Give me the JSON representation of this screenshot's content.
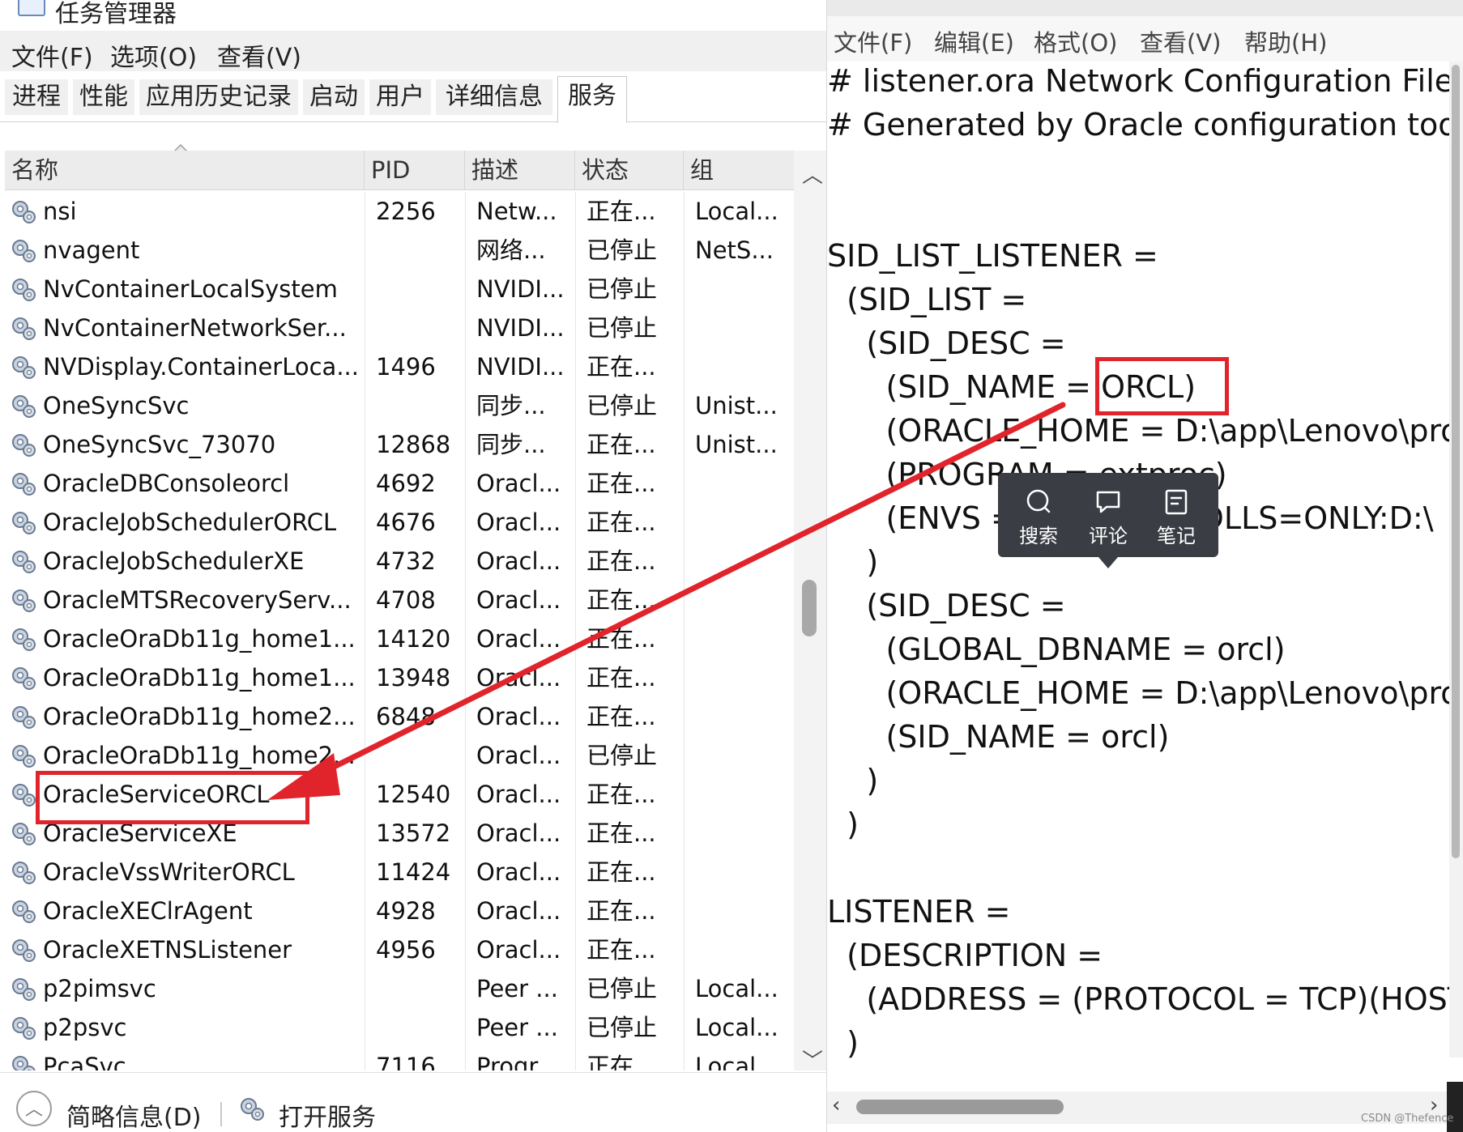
{
  "task_manager": {
    "title": "任务管理器",
    "menu": [
      "文件(F)",
      "选项(O)",
      "查看(V)"
    ],
    "tabs": [
      "进程",
      "性能",
      "应用历史记录",
      "启动",
      "用户",
      "详细信息",
      "服务"
    ],
    "active_tab": "服务",
    "columns": [
      "名称",
      "PID",
      "描述",
      "状态",
      "组"
    ],
    "rows": [
      {
        "name": "nsi",
        "pid": "2256",
        "desc": "Netw...",
        "status": "正在...",
        "group": "Local..."
      },
      {
        "name": "nvagent",
        "pid": "",
        "desc": "网络...",
        "status": "已停止",
        "group": "NetS..."
      },
      {
        "name": "NvContainerLocalSystem",
        "pid": "",
        "desc": "NVIDI...",
        "status": "已停止",
        "group": ""
      },
      {
        "name": "NvContainerNetworkSer...",
        "pid": "",
        "desc": "NVIDI...",
        "status": "已停止",
        "group": ""
      },
      {
        "name": "NVDisplay.ContainerLoca...",
        "pid": "1496",
        "desc": "NVIDI...",
        "status": "正在...",
        "group": ""
      },
      {
        "name": "OneSyncSvc",
        "pid": "",
        "desc": "同步...",
        "status": "已停止",
        "group": "Unist..."
      },
      {
        "name": "OneSyncSvc_73070",
        "pid": "12868",
        "desc": "同步...",
        "status": "正在...",
        "group": "Unist..."
      },
      {
        "name": "OracleDBConsoleorcl",
        "pid": "4692",
        "desc": "Oracl...",
        "status": "正在...",
        "group": ""
      },
      {
        "name": "OracleJobSchedulerORCL",
        "pid": "4676",
        "desc": "Oracl...",
        "status": "正在...",
        "group": ""
      },
      {
        "name": "OracleJobSchedulerXE",
        "pid": "4732",
        "desc": "Oracl...",
        "status": "正在...",
        "group": ""
      },
      {
        "name": "OracleMTSRecoveryServ...",
        "pid": "4708",
        "desc": "Oracl...",
        "status": "正在...",
        "group": ""
      },
      {
        "name": "OracleOraDb11g_home1...",
        "pid": "14120",
        "desc": "Oracl...",
        "status": "正在...",
        "group": ""
      },
      {
        "name": "OracleOraDb11g_home1...",
        "pid": "13948",
        "desc": "Oracl...",
        "status": "正在...",
        "group": ""
      },
      {
        "name": "OracleOraDb11g_home2...",
        "pid": "6848",
        "desc": "Oracl...",
        "status": "正在...",
        "group": ""
      },
      {
        "name": "OracleOraDb11g_home2...",
        "pid": "",
        "desc": "Oracl...",
        "status": "已停止",
        "group": ""
      },
      {
        "name": "OracleServiceORCL",
        "pid": "12540",
        "desc": "Oracl...",
        "status": "正在...",
        "group": ""
      },
      {
        "name": "OracleServiceXE",
        "pid": "13572",
        "desc": "Oracl...",
        "status": "正在...",
        "group": ""
      },
      {
        "name": "OracleVssWriterORCL",
        "pid": "11424",
        "desc": "Oracl...",
        "status": "正在...",
        "group": ""
      },
      {
        "name": "OracleXEClrAgent",
        "pid": "4928",
        "desc": "Oracl...",
        "status": "正在...",
        "group": ""
      },
      {
        "name": "OracleXETNSListener",
        "pid": "4956",
        "desc": "Oracl...",
        "status": "正在...",
        "group": ""
      },
      {
        "name": "p2pimsvc",
        "pid": "",
        "desc": "Peer ...",
        "status": "已停止",
        "group": "Local..."
      },
      {
        "name": "p2psvc",
        "pid": "",
        "desc": "Peer ...",
        "status": "已停止",
        "group": "Local..."
      },
      {
        "name": "PcaSvc",
        "pid": "7116",
        "desc": "Progr...",
        "status": "正在...",
        "group": "Local..."
      }
    ],
    "highlighted_row": "OracleServiceORCL",
    "status_bar": {
      "fewer_details": "简略信息(D)",
      "open_services": "打开服务"
    }
  },
  "notepad": {
    "menu": [
      "文件(F)",
      "编辑(E)",
      "格式(O)",
      "查看(V)",
      "帮助(H)"
    ],
    "lines": [
      "# listener.ora Network Configuration File",
      "# Generated by Oracle configuration tools.",
      "",
      "",
      "SID_LIST_LISTENER =",
      "  (SID_LIST =",
      "    (SID_DESC =",
      "      (SID_NAME = ORCL)",
      "      (ORACLE_HOME = D:\\app\\Lenovo\\product",
      "      (PROGRAM = extproc)",
      "      (ENVS = \"EXTPROC_DLLS=ONLY:D:\\",
      "    )",
      "    (SID_DESC =",
      "      (GLOBAL_DBNAME = orcl)",
      "      (ORACLE_HOME = D:\\app\\Lenovo\\product",
      "      (SID_NAME = orcl)",
      "    )",
      "  )",
      "",
      "LISTENER =",
      "  (DESCRIPTION =",
      "    (ADDRESS = (PROTOCOL = TCP)(HOST",
      "  )"
    ],
    "highlighted_value": "ORCL"
  },
  "popup_toolbar": {
    "buttons": [
      {
        "label": "搜索",
        "icon": "search-icon"
      },
      {
        "label": "评论",
        "icon": "comment-icon"
      },
      {
        "label": "笔记",
        "icon": "note-icon"
      }
    ]
  },
  "colors": {
    "annotation_red": "#e1242b",
    "popup_bg": "#3a3d44"
  },
  "watermark": "CSDN @Thefence"
}
